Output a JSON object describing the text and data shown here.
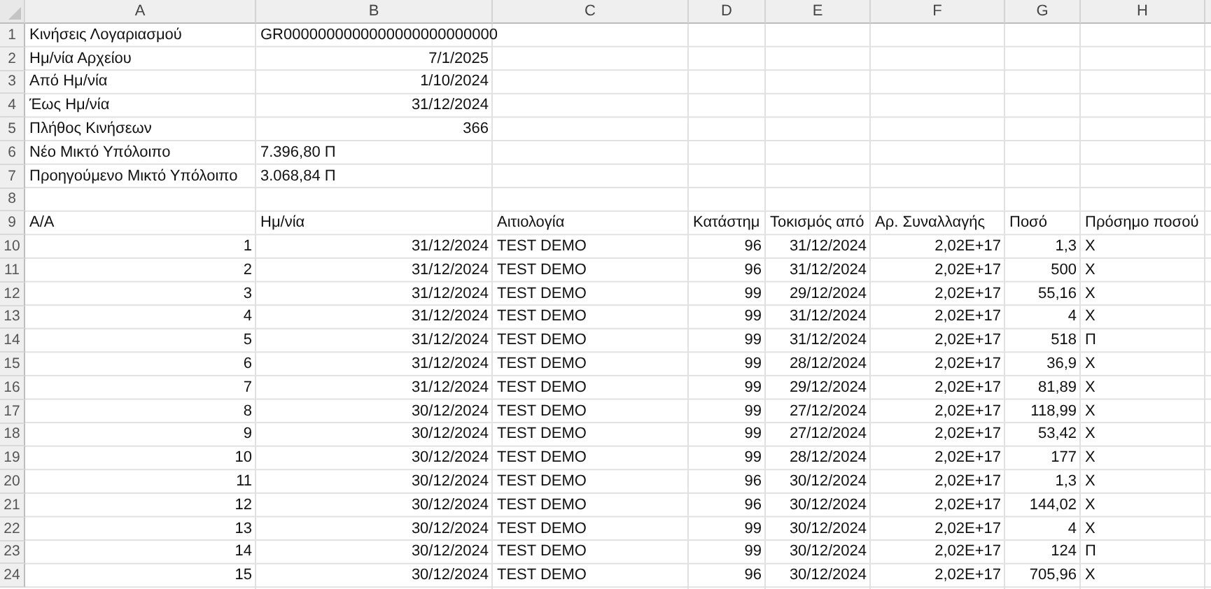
{
  "columns": [
    "A",
    "B",
    "C",
    "D",
    "E",
    "F",
    "G",
    "H"
  ],
  "info": [
    {
      "row": "1",
      "label": "Κινήσεις Λογαριασμού",
      "value": "GR0000000000000000000000000",
      "kind": "text"
    },
    {
      "row": "2",
      "label": "Ημ/νία Αρχείου",
      "value": "7/1/2025",
      "kind": "number"
    },
    {
      "row": "3",
      "label": "Από Ημ/νία",
      "value": "1/10/2024",
      "kind": "number"
    },
    {
      "row": "4",
      "label": "Έως Ημ/νία",
      "value": "31/12/2024",
      "kind": "number"
    },
    {
      "row": "5",
      "label": "Πλήθος Κινήσεων",
      "value": "366",
      "kind": "number"
    },
    {
      "row": "6",
      "label": "Νέο Μικτό Υπόλοιπο",
      "value": "7.396,80 Π",
      "kind": "text"
    },
    {
      "row": "7",
      "label": "Προηγούμενο Μικτό Υπόλοιπο",
      "value": "3.068,84 Π",
      "kind": "text"
    }
  ],
  "blank_rows": [
    "8"
  ],
  "table": {
    "header_row": "9",
    "headers": [
      "Α/Α",
      "Ημ/νία",
      "Αιτιολογία",
      "Κατάστημ",
      "Τοκισμός από",
      "Αρ. Συναλλαγής",
      "Ποσό",
      "Πρόσημο ποσού"
    ],
    "rows": [
      {
        "row": "10",
        "cells": [
          "1",
          "31/12/2024",
          "TEST DEMO",
          "96",
          "31/12/2024",
          "2,02E+17",
          "1,3",
          "Χ"
        ]
      },
      {
        "row": "11",
        "cells": [
          "2",
          "31/12/2024",
          "TEST DEMO",
          "96",
          "31/12/2024",
          "2,02E+17",
          "500",
          "Χ"
        ]
      },
      {
        "row": "12",
        "cells": [
          "3",
          "31/12/2024",
          "TEST DEMO",
          "99",
          "29/12/2024",
          "2,02E+17",
          "55,16",
          "Χ"
        ]
      },
      {
        "row": "13",
        "cells": [
          "4",
          "31/12/2024",
          "TEST DEMO",
          "99",
          "31/12/2024",
          "2,02E+17",
          "4",
          "Χ"
        ]
      },
      {
        "row": "14",
        "cells": [
          "5",
          "31/12/2024",
          "TEST DEMO",
          "99",
          "31/12/2024",
          "2,02E+17",
          "518",
          "Π"
        ]
      },
      {
        "row": "15",
        "cells": [
          "6",
          "31/12/2024",
          "TEST DEMO",
          "99",
          "28/12/2024",
          "2,02E+17",
          "36,9",
          "Χ"
        ]
      },
      {
        "row": "16",
        "cells": [
          "7",
          "31/12/2024",
          "TEST DEMO",
          "99",
          "29/12/2024",
          "2,02E+17",
          "81,89",
          "Χ"
        ]
      },
      {
        "row": "17",
        "cells": [
          "8",
          "30/12/2024",
          "TEST DEMO",
          "99",
          "27/12/2024",
          "2,02E+17",
          "118,99",
          "Χ"
        ]
      },
      {
        "row": "18",
        "cells": [
          "9",
          "30/12/2024",
          "TEST DEMO",
          "99",
          "27/12/2024",
          "2,02E+17",
          "53,42",
          "Χ"
        ]
      },
      {
        "row": "19",
        "cells": [
          "10",
          "30/12/2024",
          "TEST DEMO",
          "99",
          "28/12/2024",
          "2,02E+17",
          "177",
          "Χ"
        ]
      },
      {
        "row": "20",
        "cells": [
          "11",
          "30/12/2024",
          "TEST DEMO",
          "96",
          "30/12/2024",
          "2,02E+17",
          "1,3",
          "Χ"
        ]
      },
      {
        "row": "21",
        "cells": [
          "12",
          "30/12/2024",
          "TEST DEMO",
          "96",
          "30/12/2024",
          "2,02E+17",
          "144,02",
          "Χ"
        ]
      },
      {
        "row": "22",
        "cells": [
          "13",
          "30/12/2024",
          "TEST DEMO",
          "99",
          "30/12/2024",
          "2,02E+17",
          "4",
          "Χ"
        ]
      },
      {
        "row": "23",
        "cells": [
          "14",
          "30/12/2024",
          "TEST DEMO",
          "99",
          "30/12/2024",
          "2,02E+17",
          "124",
          "Π"
        ]
      },
      {
        "row": "24",
        "cells": [
          "15",
          "30/12/2024",
          "TEST DEMO",
          "96",
          "30/12/2024",
          "2,02E+17",
          "705,96",
          "Χ"
        ]
      }
    ]
  }
}
